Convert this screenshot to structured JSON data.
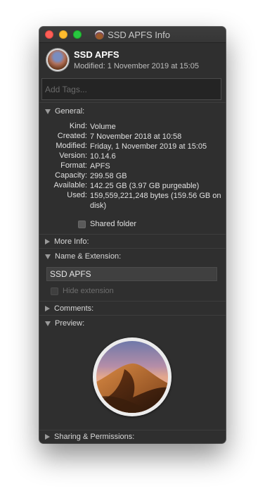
{
  "window": {
    "title": "SSD APFS Info"
  },
  "header": {
    "name": "SSD APFS",
    "modified": "Modified: 1 November 2019 at 15:05"
  },
  "tags": {
    "placeholder": "Add Tags..."
  },
  "general": {
    "label": "General:",
    "rows": [
      {
        "key": "Kind:",
        "value": "Volume"
      },
      {
        "key": "Created:",
        "value": "7 November 2018 at 10:58"
      },
      {
        "key": "Modified:",
        "value": "Friday, 1 November 2019 at 15:05"
      },
      {
        "key": "Version:",
        "value": "10.14.6"
      },
      {
        "key": "Format:",
        "value": "APFS"
      },
      {
        "key": "Capacity:",
        "value": "299.58 GB"
      },
      {
        "key": "Available:",
        "value": "142.25 GB (3.97 GB purgeable)"
      },
      {
        "key": "Used:",
        "value": "159,559,221,248 bytes (159.56 GB on disk)"
      }
    ],
    "shared_folder_label": "Shared folder",
    "shared_folder_checked": false
  },
  "more_info": {
    "label": "More Info:"
  },
  "name_extension": {
    "label": "Name & Extension:",
    "name_value": "SSD APFS",
    "hide_extension_label": "Hide extension",
    "hide_extension_checked": false
  },
  "comments": {
    "label": "Comments:"
  },
  "preview": {
    "label": "Preview:"
  },
  "sharing": {
    "label": "Sharing & Permissions:"
  },
  "colors": {
    "window_bg": "#2f2f2f",
    "text": "#e0e0e0",
    "close": "#fe5f57",
    "minimize": "#febc2e",
    "zoom": "#28c840"
  },
  "icons": [
    "window-close-icon",
    "window-minimize-icon",
    "window-zoom-icon",
    "disk-icon",
    "disclosure-triangle-icon",
    "mojave-preview-image"
  ]
}
